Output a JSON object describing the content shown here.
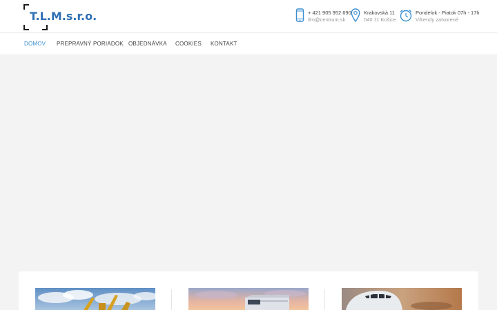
{
  "logo": {
    "text": "T.L.M.s.r.o."
  },
  "contacts": {
    "phone": {
      "line1": "+ 421 905 952 690",
      "line2": "tlm@centrum.sk"
    },
    "address": {
      "line1": "Krakovská 11",
      "line2": "040 11 Košice"
    },
    "hours": {
      "line1": "Pondelok - Piatok 07h - 17h",
      "line2": "Víkendy zatvorené"
    }
  },
  "nav": {
    "items": [
      {
        "label": "DOMOV"
      },
      {
        "label": "PREPRAVNÝ PORIADOK"
      },
      {
        "label": "OBJEDNÁVKA"
      },
      {
        "label": "COOKIES"
      },
      {
        "label": "KONTAKT"
      }
    ]
  },
  "colors": {
    "accent": "#3a8fd0",
    "logo": "#2f6fb5",
    "hero_bg": "#f3f3f3"
  },
  "icons": {
    "phone": "mobile-phone-icon",
    "address": "map-pin-icon",
    "hours": "alarm-clock-icon"
  }
}
